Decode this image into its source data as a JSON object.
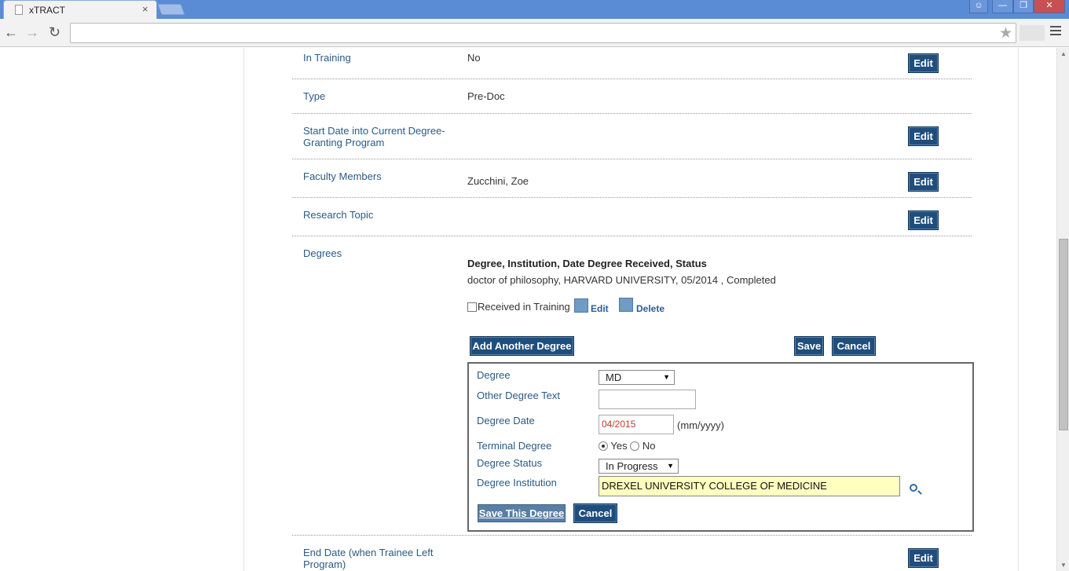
{
  "browser": {
    "tab_title": "xTRACT",
    "tab_close": "×",
    "window_buttons": [
      "user-icon",
      "minimize-icon",
      "restore-icon",
      "close-icon"
    ],
    "address": ""
  },
  "rows": {
    "in_training": {
      "label": "In Training",
      "value": "No",
      "edit": "Edit"
    },
    "type": {
      "label": "Type",
      "value": "Pre-Doc"
    },
    "start_date": {
      "label": "Start Date into Current Degree-Granting Program",
      "value": "",
      "edit": "Edit"
    },
    "faculty": {
      "label": "Faculty Members",
      "value": "Zucchini, Zoe",
      "edit": "Edit"
    },
    "research": {
      "label": "Research Topic",
      "value": "",
      "edit": "Edit"
    },
    "degrees": {
      "label": "Degrees"
    },
    "end_date": {
      "label": "End Date (when Trainee Left Program)",
      "edit": "Edit"
    }
  },
  "degrees": {
    "header": "Degree, Institution, Date Degree Received, Status",
    "record": "doctor of philosophy, HARVARD UNIVERSITY, 05/2014 , Completed",
    "received_in_training": "Received in Training",
    "edit_link": "Edit",
    "delete_link": "Delete",
    "add_another": "Add Another Degree",
    "save": "Save",
    "cancel": "Cancel"
  },
  "degree_form": {
    "degree_label": "Degree",
    "degree_value": "MD",
    "other_label": "Other Degree Text",
    "other_value": "",
    "date_label": "Degree Date",
    "date_value": "04/2015",
    "date_hint": "(mm/yyyy)",
    "terminal_label": "Terminal Degree",
    "terminal_yes": "Yes",
    "terminal_no": "No",
    "terminal_selected": "Yes",
    "status_label": "Degree Status",
    "status_value": "In Progress",
    "institution_label": "Degree Institution",
    "institution_value": "DREXEL UNIVERSITY COLLEGE OF MEDICINE",
    "save_this": "Save This Degree",
    "cancel": "Cancel"
  },
  "colors": {
    "button_dark": "#1f4e7c",
    "label_blue": "#2c5a85",
    "highlight_input": "#ffffc0",
    "date_text": "#c0392b"
  }
}
